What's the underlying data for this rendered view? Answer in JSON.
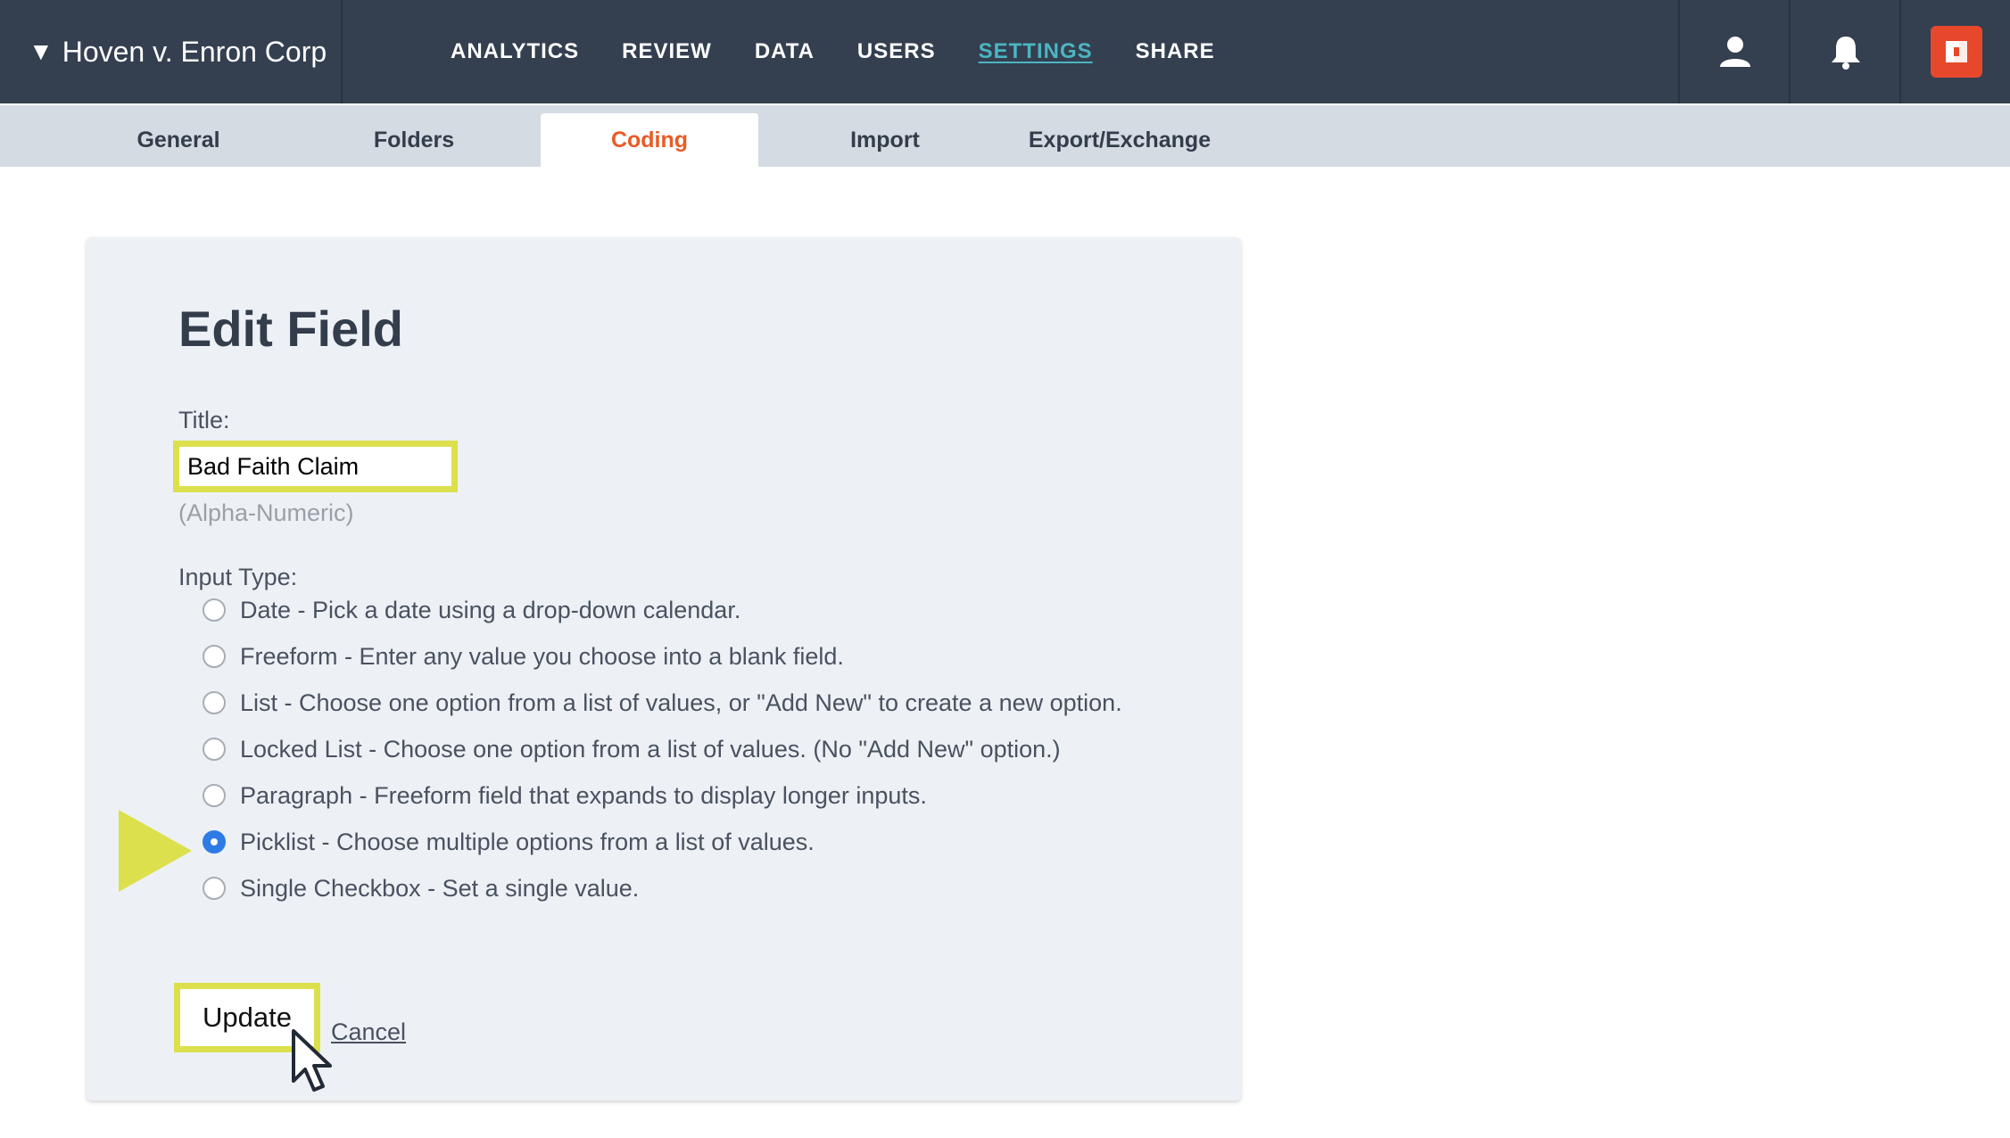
{
  "header": {
    "case_title": "Hoven v. Enron Corp",
    "nav": [
      "ANALYTICS",
      "REVIEW",
      "DATA",
      "USERS",
      "SETTINGS",
      "SHARE"
    ],
    "active_nav": "SETTINGS"
  },
  "subtabs": [
    "General",
    "Folders",
    "Coding",
    "Import",
    "Export/Exchange"
  ],
  "active_subtab": "Coding",
  "form": {
    "heading": "Edit Field",
    "title_label": "Title:",
    "title_value": "Bad Faith Claim",
    "title_hint": "(Alpha-Numeric)",
    "input_type_label": "Input Type:",
    "options": [
      "Date - Pick a date using a drop-down calendar.",
      "Freeform - Enter any value you choose into a blank field.",
      "List - Choose one option from a list of values, or \"Add New\" to create a new option.",
      "Locked List - Choose one option from a list of values. (No \"Add New\" option.)",
      "Paragraph - Freeform field that expands to display longer inputs.",
      "Picklist - Choose multiple options from a list of values.",
      "Single Checkbox - Set a single value."
    ],
    "selected_option": "Picklist - Choose multiple options from a list of values.",
    "update_label": "Update",
    "cancel_label": "Cancel"
  },
  "colors": {
    "topbar": "#343f50",
    "active_nav": "#4cb5c2",
    "active_tab": "#e85c27",
    "highlight": "#dbe04c",
    "radio_checked": "#2f7be6",
    "brand": "#e7482b"
  },
  "icons": [
    "user-icon",
    "bell-icon",
    "brand-logo-icon",
    "mouse-cursor-icon",
    "pointer-arrow-icon"
  ]
}
